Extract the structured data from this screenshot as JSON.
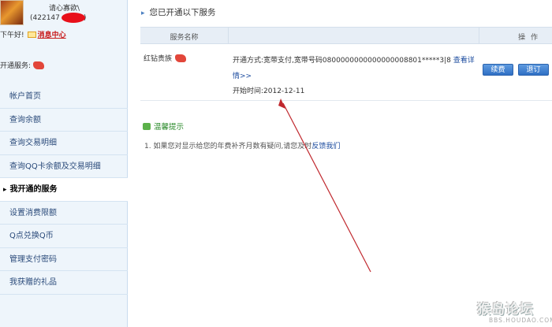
{
  "user": {
    "nick": "请心寡欲\\",
    "uid": "(422147",
    "uid_tail": ")",
    "greeting": "下午好!",
    "msg_center": "消息中心",
    "services_label": "开通服务:"
  },
  "menu": {
    "items": [
      {
        "label": "帐户首页"
      },
      {
        "label": "查询余额"
      },
      {
        "label": "查询交易明细"
      },
      {
        "label": "查询QQ卡余额及交易明细"
      },
      {
        "label": "我开通的服务"
      },
      {
        "label": "设置消费限额"
      },
      {
        "label": "Q点兑换Q币"
      },
      {
        "label": "管理支付密码"
      },
      {
        "label": "我获赠的礼品"
      }
    ],
    "active_index": 4
  },
  "main": {
    "section_title": "您已开通以下服务",
    "table": {
      "col_name": "服务名称",
      "col_op": "操 作",
      "rows": [
        {
          "name": "红钻贵族",
          "detail_prefix": "开通方式:宽带支付,宽带号码0800000000000000008801*****3|8 ",
          "detail_link": "查看详情>>",
          "start": "开始时间:2012-12-11",
          "renew": "续费",
          "cancel": "退订"
        }
      ]
    },
    "tips": {
      "title": "温馨提示",
      "line_prefix": "1.  如果您对显示给您的年费补齐月数有疑问,请您及时",
      "line_link": "反馈我们"
    }
  },
  "watermark": {
    "text": "猴岛论坛",
    "url": "BBS.HOUDAO.COM"
  },
  "colors": {
    "sidebar_bg": "#eef5fb",
    "accent_blue": "#2f6fc4",
    "annotation_red": "#c0282e",
    "link_blue": "#1a4a9e"
  }
}
